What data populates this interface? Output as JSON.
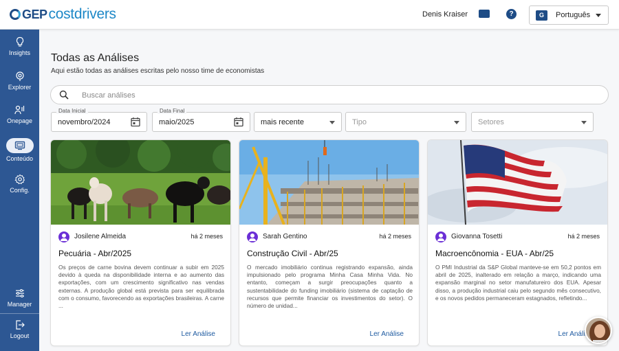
{
  "header": {
    "logo_gep": "GEP",
    "logo_product": "costdrivers",
    "user_name": "Denis Kraiser",
    "language": "Português"
  },
  "sidebar": {
    "items": [
      {
        "label": "Insights",
        "icon": "lightbulb-icon"
      },
      {
        "label": "Explorer",
        "icon": "explorer-icon"
      },
      {
        "label": "Onepage",
        "icon": "onepage-icon"
      },
      {
        "label": "Conteúdo",
        "icon": "content-icon"
      },
      {
        "label": "Config.",
        "icon": "gear-icon"
      },
      {
        "label": "Manager",
        "icon": "sliders-icon"
      },
      {
        "label": "Logout",
        "icon": "logout-icon"
      }
    ],
    "active": "Conteúdo"
  },
  "page": {
    "title": "Todas as Análises",
    "subtitle": "Aqui estão todas as análises escritas pelo nosso time de economistas"
  },
  "search": {
    "placeholder": "Buscar análises"
  },
  "filters": {
    "start_date_label": "Data Inicial",
    "start_date_value": "novembro/2024",
    "end_date_label": "Data Final",
    "end_date_value": "maio/2025",
    "sort_value": "mais recente",
    "type_placeholder": "Tipo",
    "sectors_placeholder": "Setores"
  },
  "cards": [
    {
      "author": "Josilene Almeida",
      "time": "há 2 meses",
      "title": "Pecuária - Abr/2025",
      "excerpt": "Os preços de carne bovina devem continuar a subir em 2025 devido à queda na disponibilidade interna e ao aumento das exportações, com um crescimento significativo nas vendas externas. A produção global está prevista para ser equilibrada com o consumo, favorecendo as exportações brasileiras. A carne ...",
      "link": "Ler Análise"
    },
    {
      "author": "Sarah Gentino",
      "time": "há 2 meses",
      "title": "Construção Civil - Abr/25",
      "excerpt": "O mercado imobiliário continua registrando expansão, ainda impulsionado pelo programa Minha Casa Minha Vida. No entanto, começam a surgir preocupações quanto a sustentabilidade do funding imobiliário (sistema de captação de recursos que permite financiar os investimentos do setor). O número de unidad...",
      "link": "Ler Análise"
    },
    {
      "author": "Giovanna Tosetti",
      "time": "há 2 meses",
      "title": "Macroencônomia - EUA - Abr/25",
      "excerpt": "O PMI Industrial da S&P Global manteve-se em 50,2 pontos em abril de 2025, inalterado em relação a março, indicando uma expansão marginal no setor manufatureiro dos EUA. Apesar disso, a produção industrial caiu pelo segundo mês consecutivo, e os novos pedidos permaneceram estagnados, refletindo...",
      "link": "Ler Análise"
    }
  ]
}
